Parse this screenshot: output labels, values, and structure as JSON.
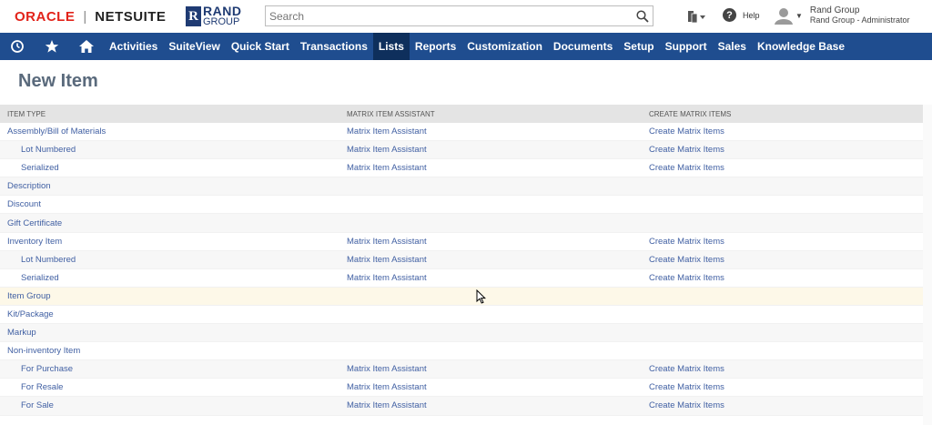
{
  "brand": {
    "oracle": "ORACLE",
    "separator": "|",
    "netsuite": "NETSUITE"
  },
  "company_logo": {
    "mark": "R",
    "line1": "RAND",
    "line2": "GROUP"
  },
  "search": {
    "placeholder": "Search",
    "icon": "search-icon"
  },
  "help": {
    "label": "Help"
  },
  "user": {
    "name": "Rand Group",
    "role": "Rand Group - Administrator"
  },
  "nav": {
    "icons": [
      "recent-icon",
      "star-icon",
      "home-icon"
    ],
    "items": [
      {
        "label": "Activities",
        "active": false
      },
      {
        "label": "SuiteView",
        "active": false
      },
      {
        "label": "Quick Start",
        "active": false
      },
      {
        "label": "Transactions",
        "active": false
      },
      {
        "label": "Lists",
        "active": true
      },
      {
        "label": "Reports",
        "active": false
      },
      {
        "label": "Customization",
        "active": false
      },
      {
        "label": "Documents",
        "active": false
      },
      {
        "label": "Setup",
        "active": false
      },
      {
        "label": "Support",
        "active": false
      },
      {
        "label": "Sales",
        "active": false
      },
      {
        "label": "Knowledge Base",
        "active": false
      }
    ],
    "colors": {
      "bar": "#1f4d8f",
      "active": "#0e2f5c"
    }
  },
  "page": {
    "title": "New Item"
  },
  "table": {
    "headers": [
      "ITEM TYPE",
      "MATRIX ITEM ASSISTANT",
      "CREATE MATRIX ITEMS"
    ],
    "rows": [
      {
        "type": "Assembly/Bill of Materials",
        "indent": false,
        "matrix": "Matrix Item Assistant",
        "create": "Create Matrix Items"
      },
      {
        "type": "Lot Numbered",
        "indent": true,
        "matrix": "Matrix Item Assistant",
        "create": "Create Matrix Items"
      },
      {
        "type": "Serialized",
        "indent": true,
        "matrix": "Matrix Item Assistant",
        "create": "Create Matrix Items"
      },
      {
        "type": "Description",
        "indent": false,
        "matrix": "",
        "create": ""
      },
      {
        "type": "Discount",
        "indent": false,
        "matrix": "",
        "create": ""
      },
      {
        "type": "Gift Certificate",
        "indent": false,
        "matrix": "",
        "create": ""
      },
      {
        "type": "Inventory Item",
        "indent": false,
        "matrix": "Matrix Item Assistant",
        "create": "Create Matrix Items"
      },
      {
        "type": "Lot Numbered",
        "indent": true,
        "matrix": "Matrix Item Assistant",
        "create": "Create Matrix Items"
      },
      {
        "type": "Serialized",
        "indent": true,
        "matrix": "Matrix Item Assistant",
        "create": "Create Matrix Items"
      },
      {
        "type": "Item Group",
        "indent": false,
        "matrix": "",
        "create": "",
        "hover": true
      },
      {
        "type": "Kit/Package",
        "indent": false,
        "matrix": "",
        "create": ""
      },
      {
        "type": "Markup",
        "indent": false,
        "matrix": "",
        "create": ""
      },
      {
        "type": "Non-inventory Item",
        "indent": false,
        "matrix": "",
        "create": ""
      },
      {
        "type": "For Purchase",
        "indent": true,
        "matrix": "Matrix Item Assistant",
        "create": "Create Matrix Items"
      },
      {
        "type": "For Resale",
        "indent": true,
        "matrix": "Matrix Item Assistant",
        "create": "Create Matrix Items"
      },
      {
        "type": "For Sale",
        "indent": true,
        "matrix": "Matrix Item Assistant",
        "create": "Create Matrix Items"
      }
    ],
    "link_color": "#4160a3"
  }
}
